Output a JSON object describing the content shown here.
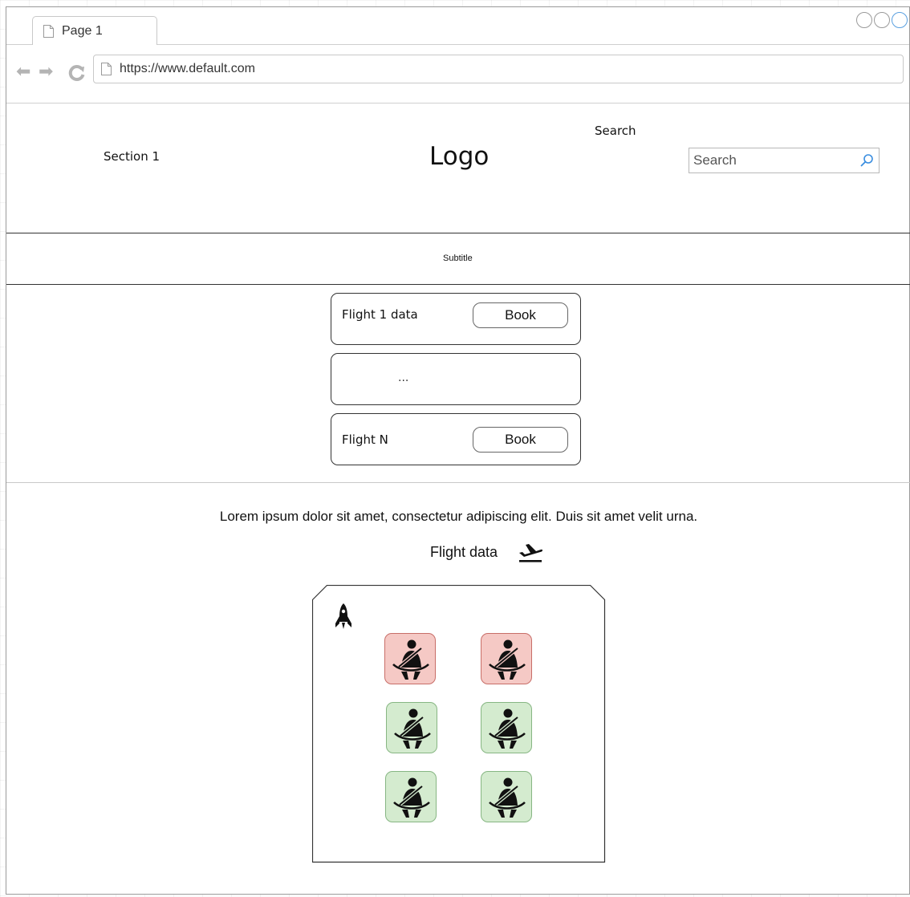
{
  "browser": {
    "tab_title": "Page 1",
    "url": "https://www.default.com",
    "nav_icons": [
      "back-arrow-icon",
      "forward-arrow-icon",
      "reload-icon",
      "page-icon"
    ],
    "window_controls": [
      "minimize-control",
      "maximize-control",
      "close-control"
    ]
  },
  "header": {
    "section_label": "Section 1",
    "logo_text": "Logo",
    "search_label": "Search",
    "search_placeholder": "Search",
    "search_icon": "magnifier-icon"
  },
  "subtitle": "Subtitle",
  "flights": [
    {
      "text": "Flight 1 data",
      "button": "Book"
    },
    {
      "text": "..."
    },
    {
      "text": "Flight N",
      "button": "Book"
    }
  ],
  "description": "Lorem ipsum dolor sit amet, consectetur adipiscing elit. Duis sit amet velit urna.",
  "flight_data_label": "Flight data",
  "flight_data_icon": "plane-takeoff-icon",
  "seat_map": {
    "icon": "rocket-icon",
    "seat_icon": "seatbelt-passenger-icon",
    "rows": [
      [
        "occupied",
        "occupied"
      ],
      [
        "available",
        "available"
      ],
      [
        "available",
        "available"
      ]
    ],
    "colors": {
      "occupied_fill": "#f5c9c5",
      "occupied_border": "#c86e68",
      "available_fill": "#d4ebcf",
      "available_border": "#87b683"
    }
  }
}
